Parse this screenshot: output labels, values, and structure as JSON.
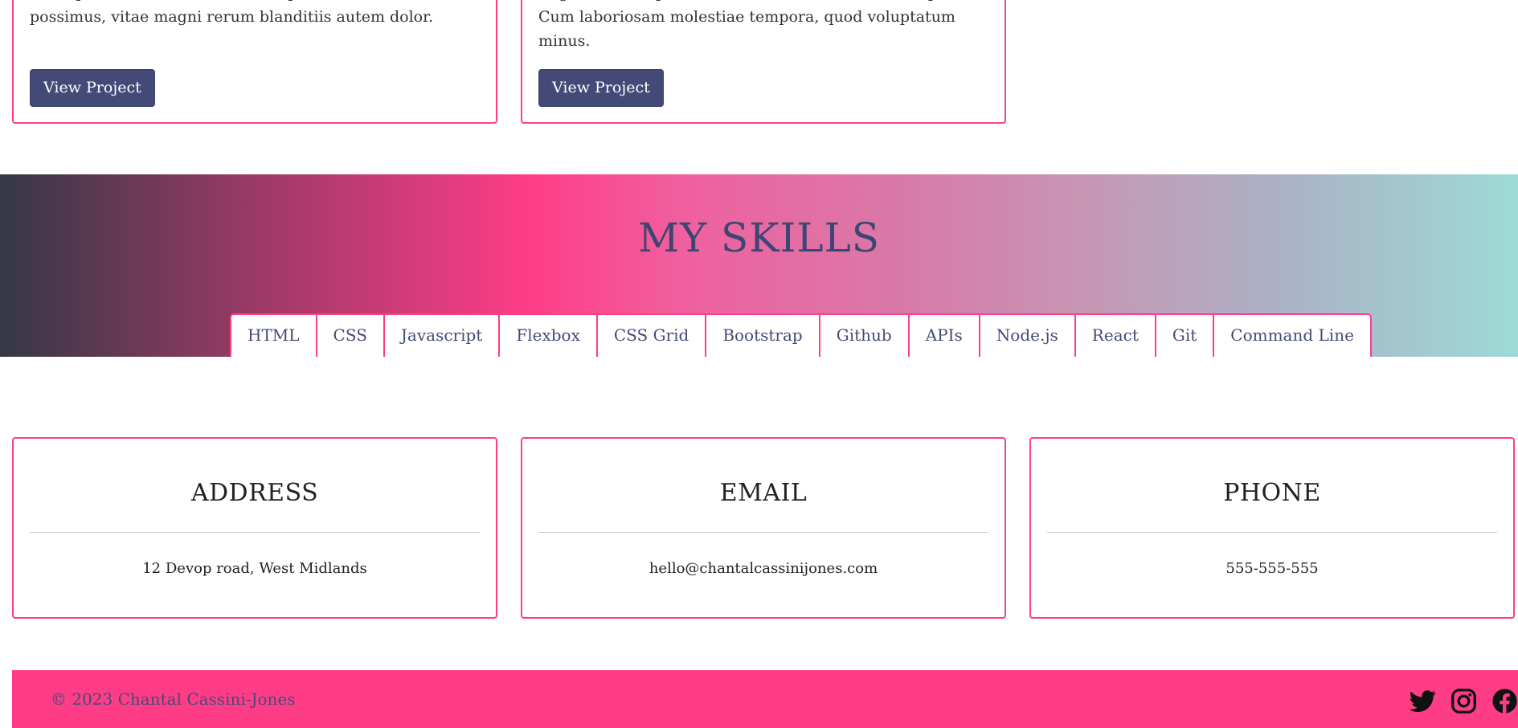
{
  "projects": [
    {
      "description": "Lorem ipsum dolor sit amet consectetur adipisicing elit. Quo, ipsa accusamus sit illum eaque eveniet sint possimus, vitae magni rerum blanditiis autem dolor.",
      "button_label": "View Project"
    },
    {
      "description": "Lorem ipsum dolor sit amet consectetur adipisicing elit. Fugiat velit aliquid, soluta distinctio maxime suscipit? Cum laboriosam molestiae tempora, quod voluptatum minus.",
      "button_label": "View Project"
    }
  ],
  "skills": {
    "title": "MY SKILLS",
    "items": [
      "HTML",
      "CSS",
      "Javascript",
      "Flexbox",
      "CSS Grid",
      "Bootstrap",
      "Github",
      "APIs",
      "Node.js",
      "React",
      "Git",
      "Command Line"
    ]
  },
  "contact": {
    "address": {
      "title": "ADDRESS",
      "value": "12 Devop road, West Midlands"
    },
    "email": {
      "title": "EMAIL",
      "value": "hello@chantalcassinijones.com"
    },
    "phone": {
      "title": "PHONE",
      "value": "555-555-555"
    }
  },
  "footer": {
    "copyright": "© 2023 Chantal Cassini-Jones",
    "social_icons": [
      "twitter-icon",
      "instagram-icon",
      "facebook-icon"
    ]
  },
  "colors": {
    "accent": "#ff3d87",
    "button": "#434a78",
    "heading": "#3d4672"
  }
}
